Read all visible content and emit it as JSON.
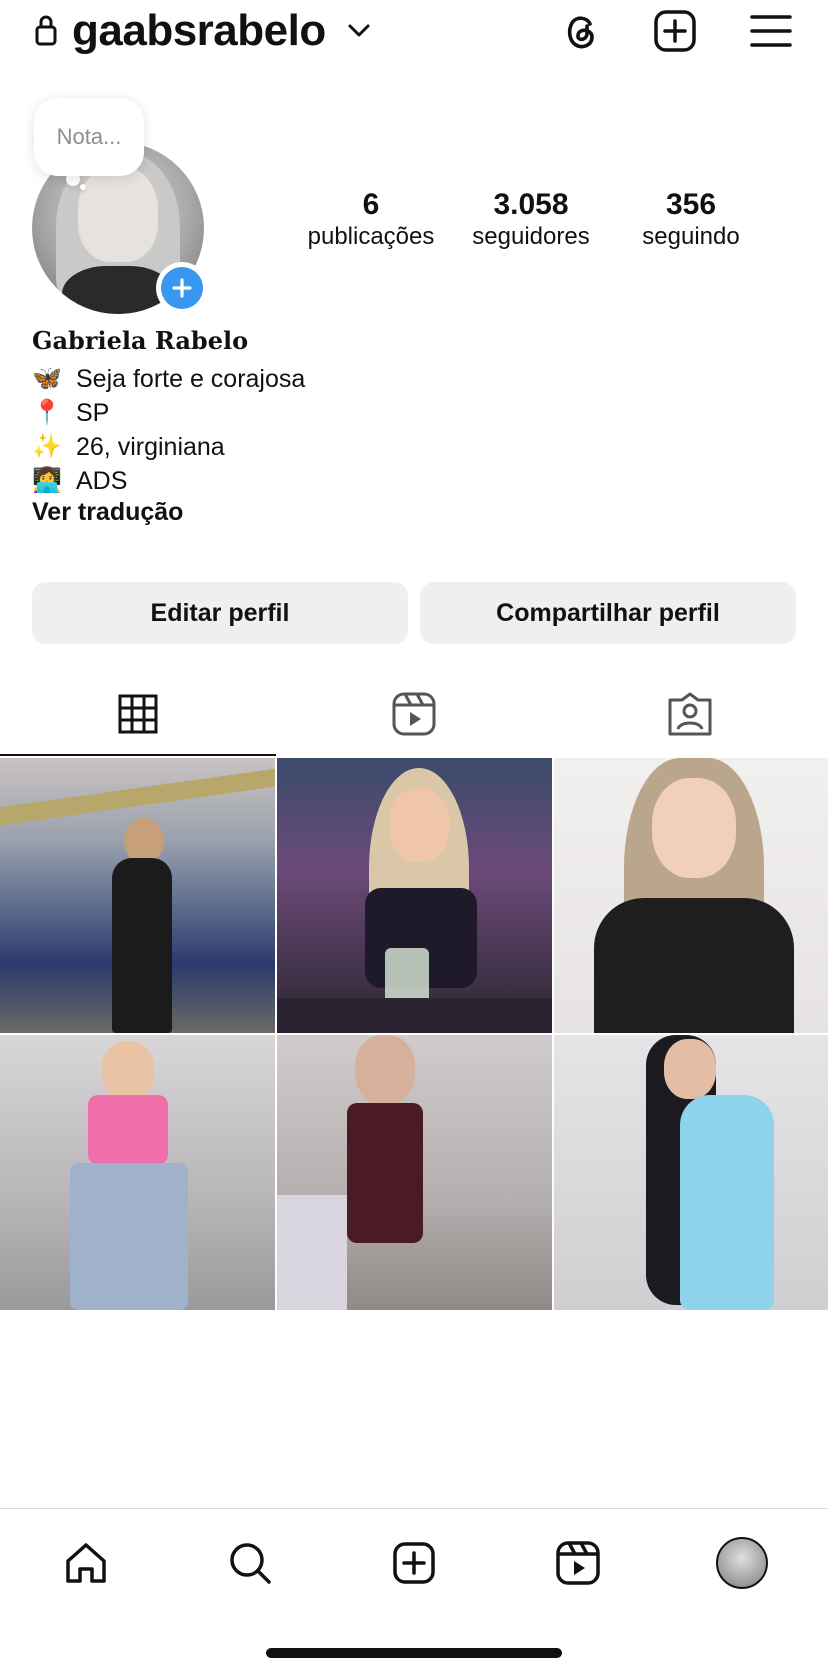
{
  "header": {
    "username": "gaabsrabelo",
    "icons": [
      "lock-icon",
      "chevron-down-icon",
      "threads-icon",
      "add-post-icon",
      "menu-icon"
    ]
  },
  "note": {
    "placeholder": "Nota..."
  },
  "stats": [
    {
      "value": "6",
      "label": "publicações"
    },
    {
      "value": "3.058",
      "label": "seguidores"
    },
    {
      "value": "356",
      "label": "seguindo"
    }
  ],
  "profile": {
    "full_name": "Gabriela Rabelo",
    "bio": [
      {
        "emoji": "🦋",
        "text": "Seja forte e corajosa"
      },
      {
        "emoji": "📍",
        "text": "SP"
      },
      {
        "emoji": "✨",
        "text": "26, virginiana"
      },
      {
        "emoji": "👩‍💻",
        "text": "ADS"
      }
    ],
    "translate_label": "Ver tradução"
  },
  "actions": {
    "edit_label": "Editar perfil",
    "share_label": "Compartilhar perfil"
  },
  "tabs": [
    "grid-icon",
    "reels-icon",
    "tagged-icon"
  ],
  "posts": [
    {
      "name": "post-balcony-black-outfit"
    },
    {
      "name": "post-bar-drink"
    },
    {
      "name": "post-portrait-black-top"
    },
    {
      "name": "post-mirror-pink-top"
    },
    {
      "name": "post-mirror-sparkly-dress"
    },
    {
      "name": "post-blue-dress"
    }
  ],
  "bottom_nav": [
    "home-icon",
    "search-icon",
    "create-icon",
    "reels-icon",
    "profile-avatar"
  ],
  "colors": {
    "accent": "#3897f0",
    "button_bg": "#efefef",
    "text": "#111111"
  }
}
